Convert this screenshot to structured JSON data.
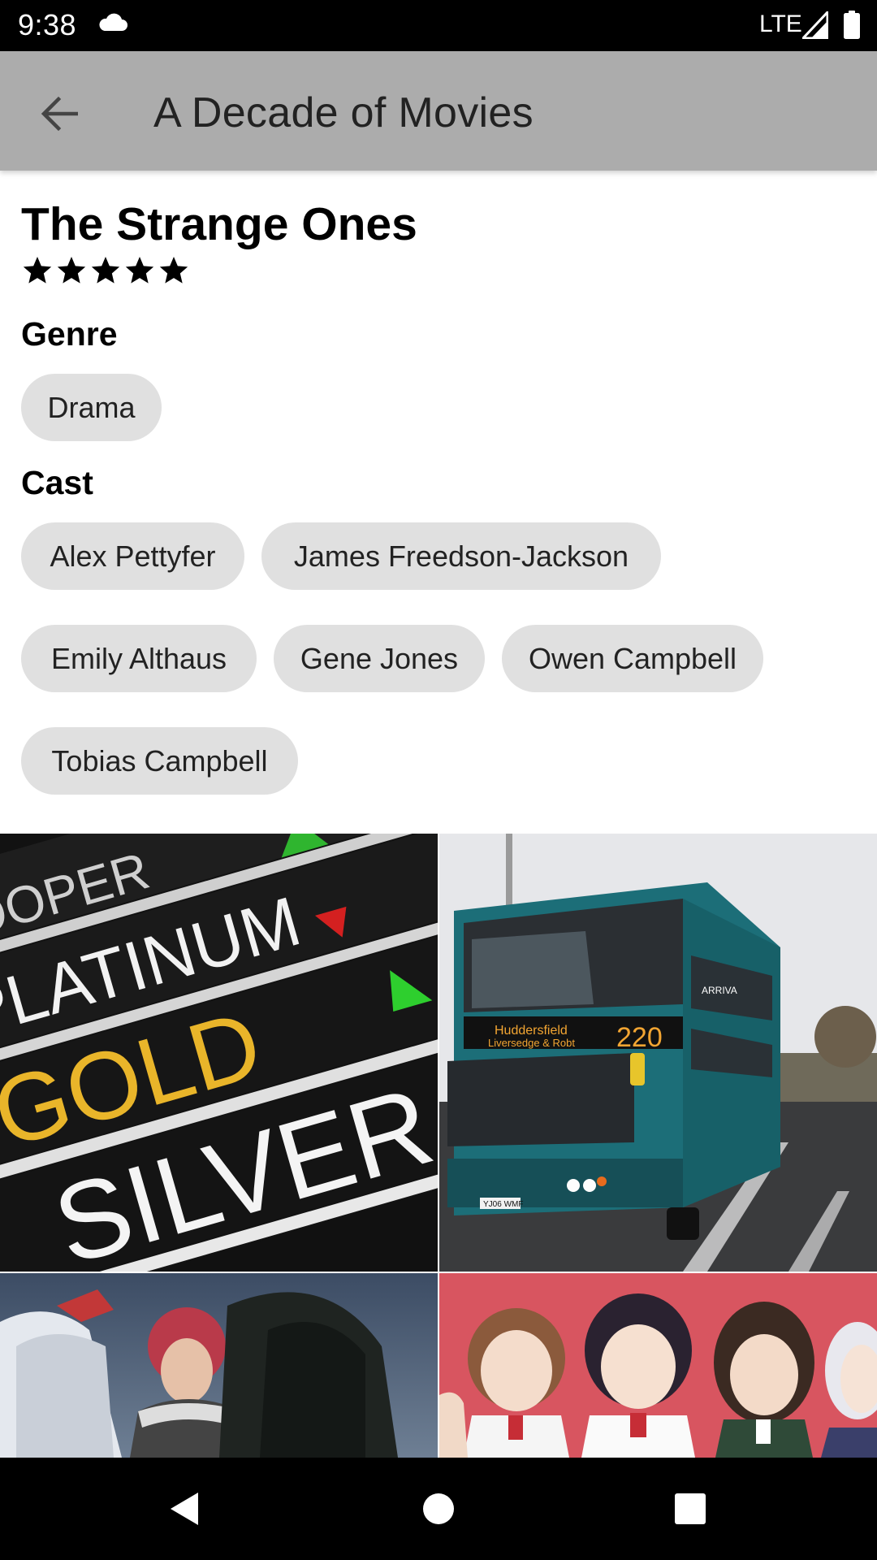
{
  "status_bar": {
    "time": "9:38",
    "network": "LTE",
    "icons": [
      "cloud-icon",
      "signal-icon",
      "battery-icon"
    ]
  },
  "app_bar": {
    "title": "A Decade of Movies",
    "back_icon": "arrow-back-icon"
  },
  "movie": {
    "title": "The Strange Ones",
    "rating": 5,
    "rating_max": 5,
    "genre_label": "Genre",
    "genres": [
      "Drama"
    ],
    "cast_label": "Cast",
    "cast": [
      "Alex Pettyfer",
      "James Freedson-Jackson",
      "Emily Althaus",
      "Gene Jones",
      "Owen Campbell",
      "Tobias Campbell"
    ]
  },
  "images": {
    "tile_1": {
      "words": [
        "COOPER",
        "PLATINUM",
        "GOLD",
        "SILVER"
      ]
    },
    "tile_2": {
      "destination": "Huddersfield",
      "via": "Liversedge & Robt",
      "route": "220",
      "operator": "ARRIVA",
      "plate": "YJ06 WMF"
    }
  },
  "colors": {
    "app_bar": "#acacac",
    "chip": "#e0e0e0",
    "status_bar": "#000000",
    "nav_bar": "#000000"
  },
  "nav_bar": {
    "icons": [
      "nav-back-icon",
      "nav-home-icon",
      "nav-recents-icon"
    ]
  }
}
